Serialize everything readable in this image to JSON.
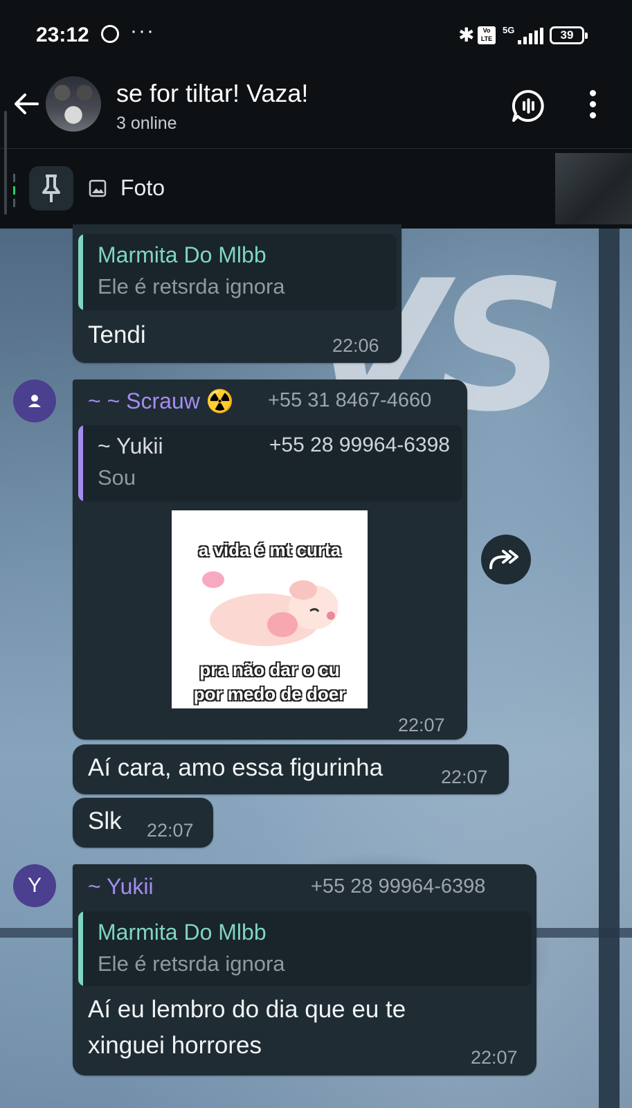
{
  "status_bar": {
    "time": "23:12",
    "dots": "···",
    "volte": "Vo\nLTE",
    "network": "5G",
    "battery": "39"
  },
  "header": {
    "title": "se for tiltar! Vaza!",
    "subtitle": "3 online"
  },
  "pinned": {
    "text": "Foto"
  },
  "messages": [
    {
      "quote": {
        "name": "Marmita Do Mlbb",
        "text": "Ele é retsrda ignora",
        "color": "#7fd6c2"
      },
      "text": "Tendi",
      "time": "22:06"
    },
    {
      "sender": "~ ~ Scrauw ☢️",
      "sender_phone": "+55 31 8467-4660",
      "sender_color": "#a58cf0",
      "quote": {
        "name": "~ Yukii",
        "phone": "+55 28 99964-6398",
        "text": "Sou",
        "color": "#a58cf0"
      },
      "sticker": {
        "line1": "a vida é mt curta",
        "line2": "pra não dar o cu",
        "line3": "por medo de doer"
      },
      "time": "22:07"
    },
    {
      "text": "Aí cara, amo essa figurinha",
      "time": "22:07"
    },
    {
      "text": "Slk",
      "time": "22:07"
    },
    {
      "avatar_letter": "Y",
      "sender": "~ Yukii",
      "sender_phone": "+55 28 99964-6398",
      "sender_color": "#a58cf0",
      "quote": {
        "name": "Marmita Do Mlbb",
        "text": "Ele é retsrda ignora",
        "color": "#7fd6c2"
      },
      "text_line1": "Aí eu lembro do dia que eu te",
      "text_line2": "xinguei horrores",
      "time": "22:07"
    }
  ],
  "colors": {
    "bubble": "#1f2c34",
    "accent_green": "#25d366",
    "quote_teal": "#7fd6c2",
    "sender_purple": "#a58cf0"
  }
}
